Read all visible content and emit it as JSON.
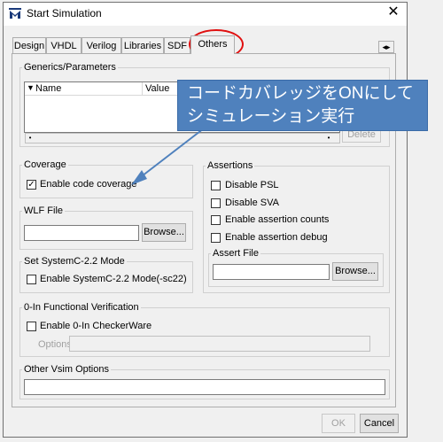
{
  "window": {
    "title": "Start Simulation",
    "close_glyph": "✕"
  },
  "tabs": [
    {
      "label": "Design"
    },
    {
      "label": "VHDL"
    },
    {
      "label": "Verilog"
    },
    {
      "label": "Libraries"
    },
    {
      "label": "SDF"
    },
    {
      "label": "Others"
    }
  ],
  "generics": {
    "legend": "Generics/Parameters",
    "col_name": "Name",
    "col_value": "Value",
    "delete_label": "Delete"
  },
  "coverage": {
    "legend": "Coverage",
    "enable_label": "Enable code coverage",
    "enable_checked": "✓"
  },
  "wlf": {
    "legend": "WLF File",
    "browse_label": "Browse..."
  },
  "systemc": {
    "legend": "Set SystemC-2.2 Mode",
    "enable_label": "Enable SystemC-2.2 Mode(-sc22)"
  },
  "assertions": {
    "legend": "Assertions",
    "disable_psl": "Disable PSL",
    "disable_sva": "Disable SVA",
    "enable_counts": "Enable assertion counts",
    "enable_debug": "Enable assertion debug",
    "assert_file_legend": "Assert File",
    "browse_label": "Browse..."
  },
  "zero_in": {
    "legend": "0-In Functional Verification",
    "enable_label": "Enable 0-In CheckerWare",
    "options_label": "Options"
  },
  "vsim": {
    "legend": "Other Vsim Options"
  },
  "footer": {
    "ok_label": "OK",
    "cancel_label": "Cancel"
  },
  "annotation": {
    "line1": "コードカバレッジをONにして",
    "line2": "シミュレーション実行",
    "color": "#4f81bd"
  },
  "highlight_color": "#e01010"
}
